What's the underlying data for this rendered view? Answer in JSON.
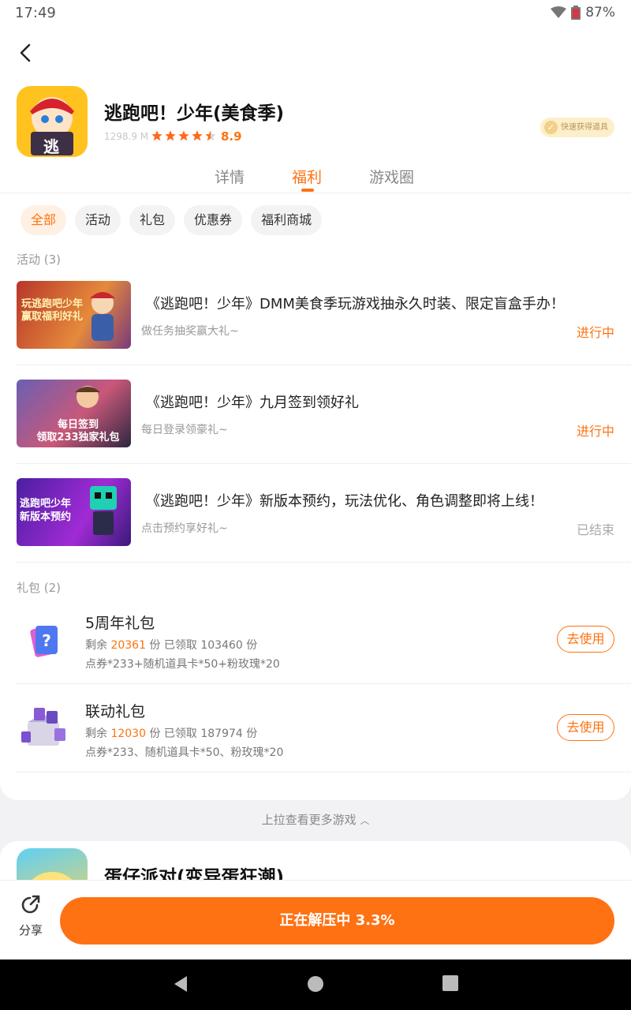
{
  "status_bar": {
    "time": "17:49",
    "battery": "87%"
  },
  "game": {
    "title": "逃跑吧！少年(美食季)",
    "size": "1298.9 M",
    "rating": "8.9",
    "stars": 4.5,
    "icon_char": "逃",
    "badge": "快速获得道具"
  },
  "tabs": [
    {
      "label": "详情"
    },
    {
      "label": "福利"
    },
    {
      "label": "游戏圈"
    }
  ],
  "active_tab": "福利",
  "chips": [
    {
      "label": "全部"
    },
    {
      "label": "活动"
    },
    {
      "label": "礼包"
    },
    {
      "label": "优惠券"
    },
    {
      "label": "福利商城"
    }
  ],
  "activities_header": "活动 (3)",
  "activities": [
    {
      "title": "《逃跑吧！少年》DMM美食季玩游戏抽永久时装、限定盲盒手办！",
      "subtitle": "做任务抽奖赢大礼~",
      "status": "进行中",
      "thumb_text": "玩逃跑吧少年\n赢取福利好礼"
    },
    {
      "title": "《逃跑吧！少年》九月签到领好礼",
      "subtitle": "每日登录领豪礼~",
      "status": "进行中",
      "thumb_text": "每日签到\n领取233独家礼包"
    },
    {
      "title": "《逃跑吧！少年》新版本预约，玩法优化、角色调整即将上线！",
      "subtitle": "点击预约享好礼~",
      "status": "已结束",
      "thumb_text": "逃跑吧少年\n新版本预约"
    }
  ],
  "gifts_header": "礼包 (2)",
  "gifts": [
    {
      "name": "5周年礼包",
      "remaining_label": "剩余",
      "remaining": "20361",
      "unit": "份",
      "claimed_label": "已领取",
      "claimed": "103460",
      "contents": "点券*233+随机道具卡*50+粉玫瑰*20",
      "button": "去使用"
    },
    {
      "name": "联动礼包",
      "remaining_label": "剩余",
      "remaining": "12030",
      "unit": "份",
      "claimed_label": "已领取",
      "claimed": "187974",
      "contents": "点券*233、随机道具卡*50、粉玫瑰*20",
      "button": "去使用"
    }
  ],
  "pull_more": "上拉查看更多游戏",
  "next_game": {
    "title": "蛋仔派对(变异蛋狂潮)"
  },
  "bottom": {
    "share_label": "分享",
    "main_button": "正在解压中 3.3%"
  },
  "colors": {
    "accent": "#ff7210",
    "badge_bg": "#fcefc9"
  }
}
